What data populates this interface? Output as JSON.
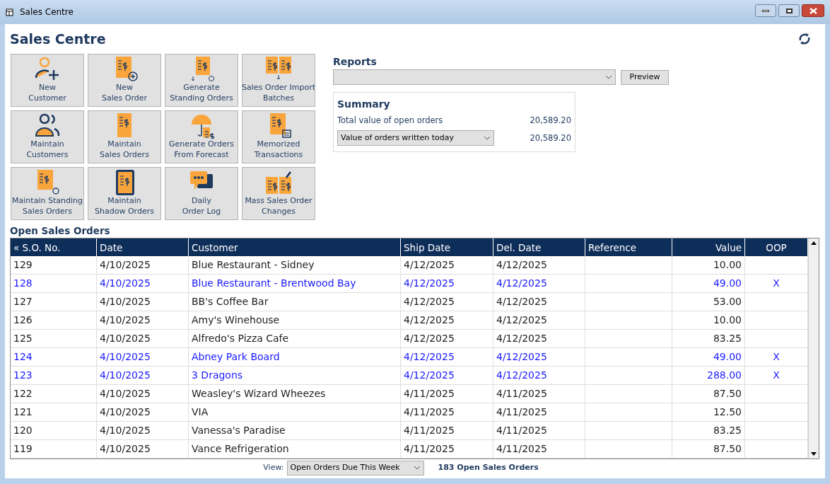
{
  "window": {
    "title": "Sales Centre"
  },
  "heading": "Sales Centre",
  "tiles": [
    {
      "line1": "New",
      "line2": "Customer"
    },
    {
      "line1": "New",
      "line2": "Sales Order"
    },
    {
      "line1": "Generate",
      "line2": "Standing Orders"
    },
    {
      "line1": "Sales Order Import",
      "line2": "Batches"
    },
    {
      "line1": "Maintain",
      "line2": "Customers"
    },
    {
      "line1": "Maintain",
      "line2": "Sales Orders"
    },
    {
      "line1": "Generate Orders",
      "line2": "From Forecast"
    },
    {
      "line1": "Memorized",
      "line2": "Transactions"
    },
    {
      "line1": "Maintain Standing",
      "line2": "Sales Orders"
    },
    {
      "line1": "Maintain",
      "line2": "Shadow Orders"
    },
    {
      "line1": "Daily",
      "line2": "Order Log"
    },
    {
      "line1": "Mass Sales Order",
      "line2": "Changes"
    }
  ],
  "reports": {
    "title": "Reports",
    "preview_button": "Preview"
  },
  "summary": {
    "title": "Summary",
    "total_label": "Total value of open orders",
    "total_value": "20,589.20",
    "period_select": "Value of orders written today",
    "period_value": "20,589.20"
  },
  "orders": {
    "title": "Open Sales Orders",
    "columns": [
      "« S.O. No.",
      "Date",
      "Customer",
      "Ship Date",
      "Del. Date",
      "Reference",
      "Value",
      "OOP"
    ],
    "rows": [
      {
        "cells": [
          "129",
          "4/10/2025",
          "Blue Restaurant - Sidney",
          "4/12/2025",
          "4/12/2025",
          "",
          "10.00",
          ""
        ],
        "flagged": false
      },
      {
        "cells": [
          "128",
          "4/10/2025",
          "Blue Restaurant - Brentwood Bay",
          "4/12/2025",
          "4/12/2025",
          "",
          "49.00",
          "X"
        ],
        "flagged": true
      },
      {
        "cells": [
          "127",
          "4/10/2025",
          "BB's Coffee Bar",
          "4/12/2025",
          "4/12/2025",
          "",
          "53.00",
          ""
        ],
        "flagged": false
      },
      {
        "cells": [
          "126",
          "4/10/2025",
          "Amy's Winehouse",
          "4/12/2025",
          "4/12/2025",
          "",
          "10.00",
          ""
        ],
        "flagged": false
      },
      {
        "cells": [
          "125",
          "4/10/2025",
          "Alfredo's Pizza Cafe",
          "4/12/2025",
          "4/12/2025",
          "",
          "83.25",
          ""
        ],
        "flagged": false
      },
      {
        "cells": [
          "124",
          "4/10/2025",
          "Abney Park Board",
          "4/12/2025",
          "4/12/2025",
          "",
          "49.00",
          "X"
        ],
        "flagged": true
      },
      {
        "cells": [
          "123",
          "4/10/2025",
          "3 Dragons",
          "4/12/2025",
          "4/12/2025",
          "",
          "288.00",
          "X"
        ],
        "flagged": true
      },
      {
        "cells": [
          "122",
          "4/10/2025",
          "Weasley's Wizard Wheezes",
          "4/11/2025",
          "4/11/2025",
          "",
          "87.50",
          ""
        ],
        "flagged": false
      },
      {
        "cells": [
          "121",
          "4/10/2025",
          "VIA",
          "4/11/2025",
          "4/11/2025",
          "",
          "12.50",
          ""
        ],
        "flagged": false
      },
      {
        "cells": [
          "120",
          "4/10/2025",
          "Vanessa's Paradise",
          "4/11/2025",
          "4/11/2025",
          "",
          "83.25",
          ""
        ],
        "flagged": false
      },
      {
        "cells": [
          "119",
          "4/10/2025",
          "Vance Refrigeration",
          "4/11/2025",
          "4/11/2025",
          "",
          "87.50",
          ""
        ],
        "flagged": false
      }
    ]
  },
  "footer": {
    "view_label": "View:",
    "view_select": "Open Orders Due This Week",
    "count": "183 Open Sales Orders"
  }
}
